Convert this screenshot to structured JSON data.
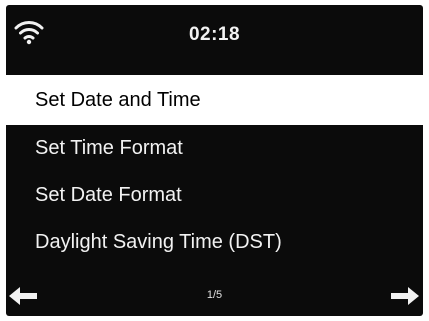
{
  "status": {
    "wifi_icon": "wifi-icon",
    "time": "02:18"
  },
  "menu": {
    "items": [
      {
        "label": "Set Date and Time",
        "selected": true
      },
      {
        "label": "Set Time Format",
        "selected": false
      },
      {
        "label": "Set Date Format",
        "selected": false
      },
      {
        "label": "Daylight Saving Time (DST)",
        "selected": false
      }
    ]
  },
  "nav": {
    "left_icon": "arrow-left-icon",
    "right_icon": "arrow-right-icon",
    "page": "1/5"
  },
  "colors": {
    "screen_background": "#0b0b0b",
    "text": "#f2f2f2",
    "highlight_background": "#ffffff",
    "highlight_text": "#000000"
  }
}
